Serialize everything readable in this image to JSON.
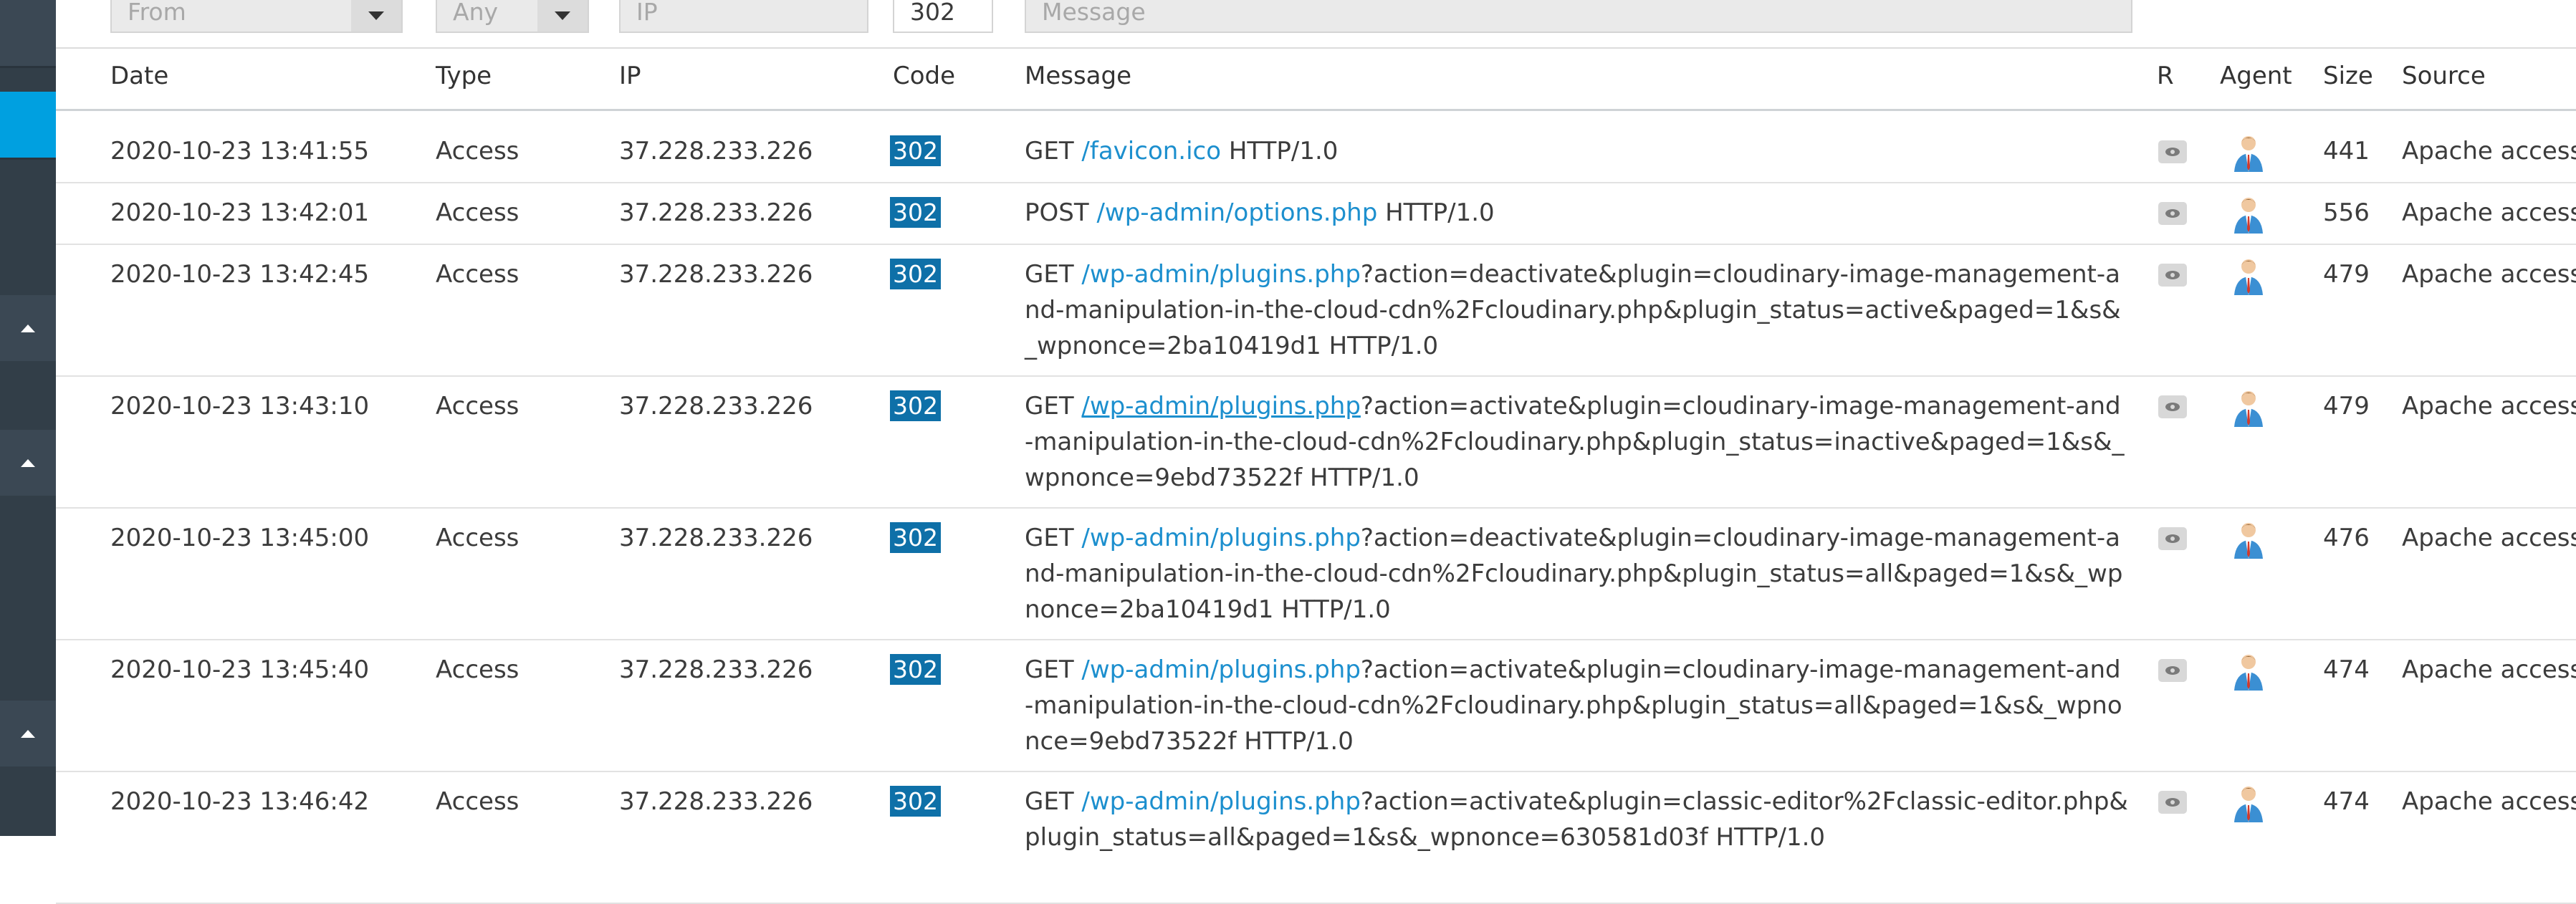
{
  "filters": {
    "from_placeholder": "From",
    "type_value": "Any",
    "ip_placeholder": "IP",
    "code_value": "302",
    "message_placeholder": "Message"
  },
  "columns": {
    "date": "Date",
    "type": "Type",
    "ip": "IP",
    "code": "Code",
    "message": "Message",
    "r": "R",
    "agent": "Agent",
    "size": "Size",
    "source": "Source"
  },
  "rows": [
    {
      "date": "2020-10-23 13:41:55",
      "type": "Access",
      "ip": "37.228.233.226",
      "code": "302",
      "method": "GET",
      "path": "/favicon.ico",
      "rest": " HTTP/1.0",
      "size": "441",
      "source": "Apache access"
    },
    {
      "date": "2020-10-23 13:42:01",
      "type": "Access",
      "ip": "37.228.233.226",
      "code": "302",
      "method": "POST",
      "path": "/wp-admin/options.php",
      "rest": " HTTP/1.0",
      "size": "556",
      "source": "Apache access"
    },
    {
      "date": "2020-10-23 13:42:45",
      "type": "Access",
      "ip": "37.228.233.226",
      "code": "302",
      "method": "GET",
      "path": "/wp-admin/plugins.php",
      "rest": "?action=deactivate&plugin=cloudinary-image-management-and-manipulation-in-the-cloud-cdn%2Fcloudinary.php&plugin_status=active&paged=1&s&_wpnonce=2ba10419d1 HTTP/1.0",
      "size": "479",
      "source": "Apache access"
    },
    {
      "date": "2020-10-23 13:43:10",
      "type": "Access",
      "ip": "37.228.233.226",
      "code": "302",
      "method": "GET",
      "path": "/wp-admin/plugins.php",
      "rest": "?action=activate&plugin=cloudinary-image-management-and-manipulation-in-the-cloud-cdn%2Fcloudinary.php&plugin_status=inactive&paged=1&s&_wpnonce=9ebd73522f HTTP/1.0",
      "size": "479",
      "source": "Apache access"
    },
    {
      "date": "2020-10-23 13:45:00",
      "type": "Access",
      "ip": "37.228.233.226",
      "code": "302",
      "method": "GET",
      "path": "/wp-admin/plugins.php",
      "rest": "?action=deactivate&plugin=cloudinary-image-management-and-manipulation-in-the-cloud-cdn%2Fcloudinary.php&plugin_status=all&paged=1&s&_wpnonce=2ba10419d1 HTTP/1.0",
      "size": "476",
      "source": "Apache access"
    },
    {
      "date": "2020-10-23 13:45:40",
      "type": "Access",
      "ip": "37.228.233.226",
      "code": "302",
      "method": "GET",
      "path": "/wp-admin/plugins.php",
      "rest": "?action=activate&plugin=cloudinary-image-management-and-manipulation-in-the-cloud-cdn%2Fcloudinary.php&plugin_status=all&paged=1&s&_wpnonce=9ebd73522f HTTP/1.0",
      "size": "474",
      "source": "Apache access"
    },
    {
      "date": "2020-10-23 13:46:42",
      "type": "Access",
      "ip": "37.228.233.226",
      "code": "302",
      "method": "GET",
      "path": "/wp-admin/plugins.php",
      "rest": "?action=activate&plugin=classic-editor%2Fclassic-editor.php&plugin_status=all&paged=1&s&_wpnonce=630581d03f HTTP/1.0",
      "size": "474",
      "source": "Apache access"
    }
  ]
}
